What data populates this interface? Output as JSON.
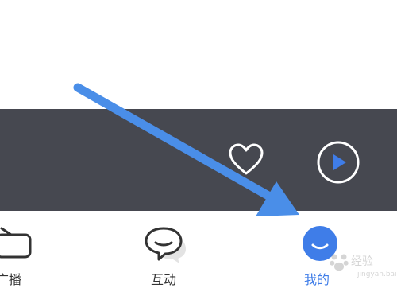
{
  "player": {
    "like_icon": "heart-outline-icon",
    "play_icon": "play-circle-icon"
  },
  "tabs": [
    {
      "label": "广播",
      "icon": "radio-tv-icon",
      "active": false
    },
    {
      "label": "互动",
      "icon": "chat-bubbles-icon",
      "active": false
    },
    {
      "label": "我的",
      "icon": "profile-smile-icon",
      "active": true
    }
  ],
  "colors": {
    "player_bg": "#464850",
    "accent": "#3f7de8",
    "annotation_arrow": "#4a8ee8"
  },
  "watermark": {
    "text": "经验",
    "sub": "jingyan.baidu.com"
  }
}
